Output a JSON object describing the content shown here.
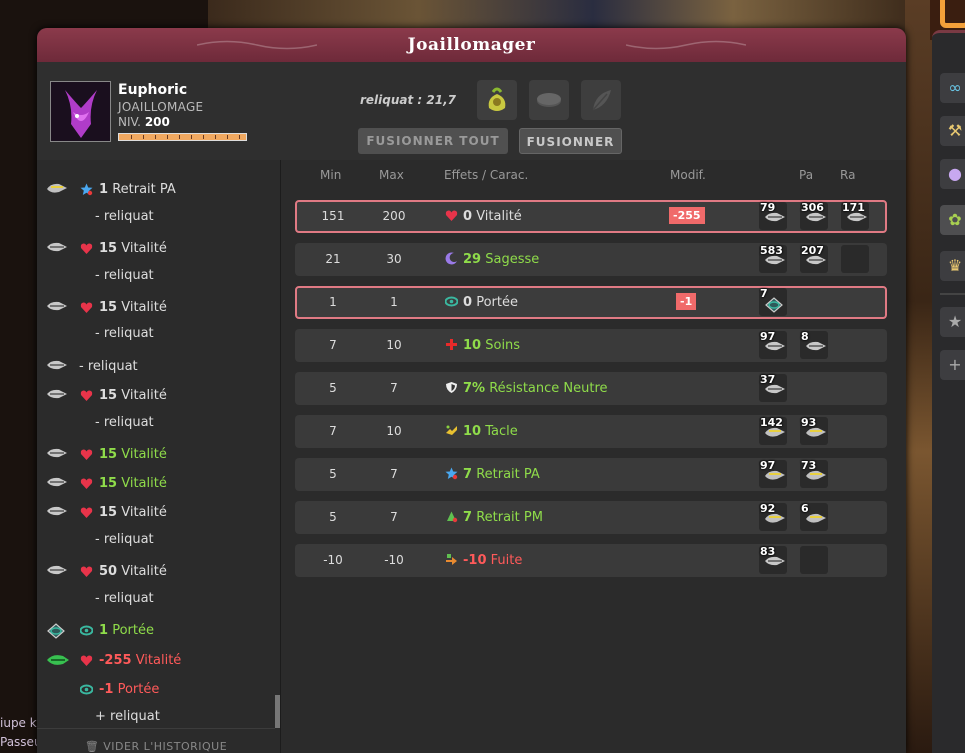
{
  "window": {
    "title": "Joaillomager"
  },
  "character": {
    "name": "Euphoric",
    "job": "JOAILLOMAGE",
    "level_prefix": "NIV.",
    "level": "200",
    "xp_fraction": 1.0
  },
  "reliquat": "reliquat : 21,7",
  "buttons": {
    "fusion_all": "FUSIONNER TOUT",
    "fusion": "FUSIONNER"
  },
  "history": {
    "rows": [
      {
        "num": "1",
        "label": "Retrait PA",
        "effect": "pa",
        "color": "default",
        "rune": "pa"
      },
      {
        "label": "- reliquat",
        "indent": true
      },
      {
        "num": "15",
        "label": "Vitalité",
        "effect": "vita",
        "color": "default",
        "rune": "vita"
      },
      {
        "label": "- reliquat",
        "indent": true
      },
      {
        "num": "15",
        "label": "Vitalité",
        "effect": "vita",
        "color": "default",
        "rune": "vita"
      },
      {
        "label": "- reliquat",
        "indent": true
      },
      {
        "label": "- reliquat",
        "rune": "vita"
      },
      {
        "num": "15",
        "label": "Vitalité",
        "effect": "vita",
        "color": "default",
        "rune": "vita"
      },
      {
        "label": "- reliquat",
        "indent": true
      },
      {
        "num": "15",
        "label": "Vitalité",
        "effect": "vita",
        "color": "green",
        "rune": "vita"
      },
      {
        "num": "15",
        "label": "Vitalité",
        "effect": "vita",
        "color": "green",
        "rune": "vita"
      },
      {
        "num": "15",
        "label": "Vitalité",
        "effect": "vita",
        "color": "default",
        "rune": "vita"
      },
      {
        "label": "- reliquat",
        "indent": true
      },
      {
        "num": "50",
        "label": "Vitalité",
        "effect": "vita",
        "color": "default",
        "rune": "vita"
      },
      {
        "label": "- reliquat",
        "indent": true
      },
      {
        "num": "1",
        "label": "Portée",
        "effect": "po",
        "color": "green",
        "rune": "po"
      },
      {
        "num": "-255",
        "label": "Vitalité",
        "effect": "vita",
        "color": "red",
        "rune": "green"
      },
      {
        "num": "-1",
        "label": "Portée",
        "effect": "po",
        "color": "red"
      },
      {
        "label": "+ reliquat",
        "indent": true
      }
    ],
    "clear_label": "VIDER L'HISTORIQUE"
  },
  "table": {
    "headers": {
      "min": "Min",
      "max": "Max",
      "effect": "Effets / Carac.",
      "modif": "Modif.",
      "pa": "Pa",
      "ra": "Ra"
    },
    "rows": [
      {
        "min": "151",
        "max": "200",
        "value": "0",
        "label": "Vitalité",
        "effect": "vita",
        "color": "default",
        "modif": "-255",
        "highlight": true,
        "runes": [
          {
            "count": "79"
          },
          {
            "count": "306"
          },
          {
            "count": "171"
          }
        ]
      },
      {
        "min": "21",
        "max": "30",
        "value": "29",
        "label": "Sagesse",
        "effect": "sage",
        "color": "green",
        "modif": "",
        "highlight": false,
        "runes": [
          {
            "count": "583"
          },
          {
            "count": "207"
          },
          {
            "count": ""
          }
        ]
      },
      {
        "min": "1",
        "max": "1",
        "value": "0",
        "label": "Portée",
        "effect": "po",
        "color": "default",
        "modif": "-1",
        "highlight": true,
        "runes": [
          {
            "count": "7"
          }
        ]
      },
      {
        "min": "7",
        "max": "10",
        "value": "10",
        "label": "Soins",
        "effect": "soin",
        "color": "green",
        "modif": "",
        "highlight": false,
        "runes": [
          {
            "count": "97"
          },
          {
            "count": "8"
          }
        ]
      },
      {
        "min": "5",
        "max": "7",
        "value": "7%",
        "label": "Résistance Neutre",
        "effect": "res",
        "color": "green",
        "modif": "",
        "highlight": false,
        "runes": [
          {
            "count": "37"
          }
        ]
      },
      {
        "min": "7",
        "max": "10",
        "value": "10",
        "label": "Tacle",
        "effect": "tacle",
        "color": "green",
        "modif": "",
        "highlight": false,
        "runes": [
          {
            "count": "142"
          },
          {
            "count": "93"
          }
        ]
      },
      {
        "min": "5",
        "max": "7",
        "value": "7",
        "label": "Retrait PA",
        "effect": "pa",
        "color": "green",
        "modif": "",
        "highlight": false,
        "runes": [
          {
            "count": "97"
          },
          {
            "count": "73"
          }
        ]
      },
      {
        "min": "5",
        "max": "7",
        "value": "7",
        "label": "Retrait PM",
        "effect": "pm",
        "color": "green",
        "modif": "",
        "highlight": false,
        "runes": [
          {
            "count": "92"
          },
          {
            "count": "6"
          }
        ]
      },
      {
        "min": "-10",
        "max": "-10",
        "value": "-10",
        "label": "Fuite",
        "effect": "fuite",
        "color": "red",
        "modif": "",
        "highlight": false,
        "runes": [
          {
            "count": "83"
          },
          {
            "count": ""
          }
        ]
      }
    ]
  },
  "background": {
    "bottom_left_text_1": "iupe k",
    "bottom_left_text_2": "Passeu"
  },
  "colors": {
    "title_bar": "#7a3040",
    "highlight_border": "#e07a84",
    "positive": "#8fdc4a",
    "negative": "#ff5a5a",
    "modif_badge": "#f06a6a"
  }
}
